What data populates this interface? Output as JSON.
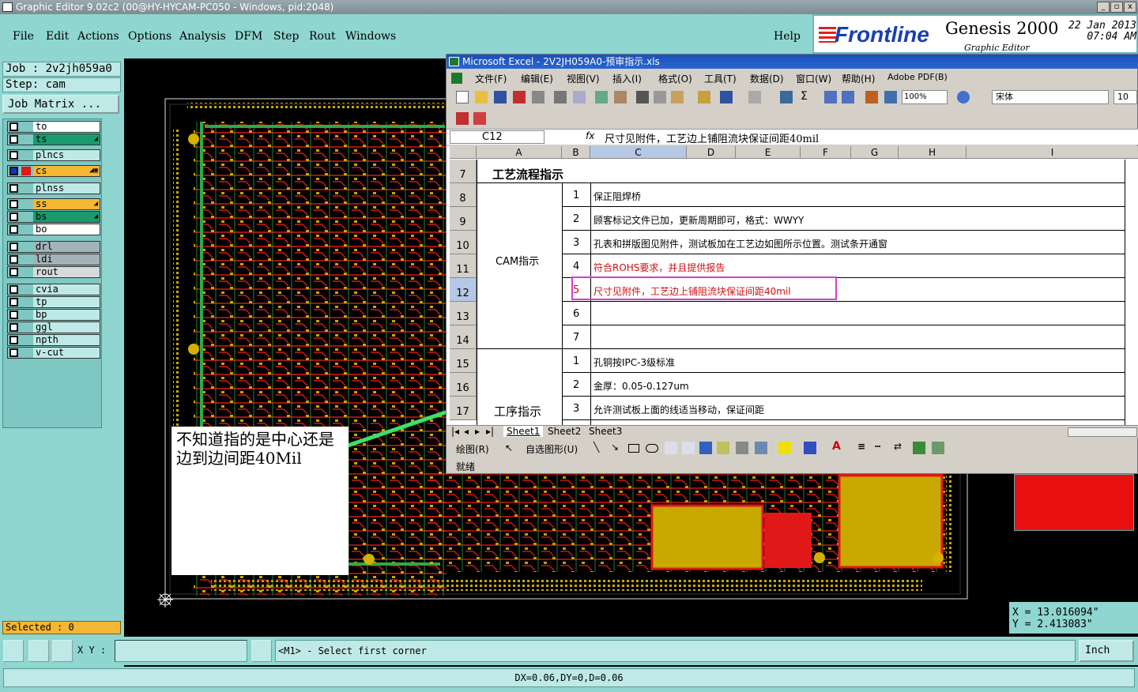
{
  "app": {
    "title": "Graphic Editor 9.02c2 (00@HY-HYCAM-PC050 - Windows, pid:2048)",
    "window_controls": [
      "_",
      "▫",
      "x"
    ]
  },
  "menu": [
    "File",
    "Edit",
    "Actions",
    "Options",
    "Analysis",
    "DFM",
    "Step",
    "Rout",
    "Windows"
  ],
  "help": "Help",
  "brand": {
    "logo": "Frontline",
    "product": "Genesis 2000",
    "subtitle": "Graphic Editor",
    "date": "22 Jan 2013",
    "time": "07:04 AM"
  },
  "job": {
    "job_line": "Job : 2v2jh059a0",
    "step_line": "Step: cam",
    "matrix_button": "Job Matrix ..."
  },
  "layers": [
    {
      "name": "to",
      "color": "#ffffff",
      "flag": ""
    },
    {
      "name": "ts",
      "color": "#1a9a6e",
      "flag": "◢"
    },
    {
      "name": "plncs",
      "color": "#bfe9e6",
      "flag": ""
    },
    {
      "name": "cs",
      "color": "#f5b733",
      "flag": "◢▣"
    },
    {
      "name": "plnss",
      "color": "#bfe9e6",
      "flag": ""
    },
    {
      "name": "ss",
      "color": "#f5b733",
      "flag": "◢"
    },
    {
      "name": "bs",
      "color": "#1a9a6e",
      "flag": "◢"
    },
    {
      "name": "bo",
      "color": "#ffffff",
      "flag": ""
    },
    {
      "name": "drl",
      "color": "#a4b3ba",
      "flag": ""
    },
    {
      "name": "ldi",
      "color": "#a4b3ba",
      "flag": ""
    },
    {
      "name": "rout",
      "color": "#d8dada",
      "flag": ""
    },
    {
      "name": "cvia",
      "color": "#bfe9e6",
      "flag": ""
    },
    {
      "name": "tp",
      "color": "#bfe9e6",
      "flag": ""
    },
    {
      "name": "bp",
      "color": "#bfe9e6",
      "flag": ""
    },
    {
      "name": "ggl",
      "color": "#bfe9e6",
      "flag": ""
    },
    {
      "name": "npth",
      "color": "#bfe9e6",
      "flag": ""
    },
    {
      "name": "v-cut",
      "color": "#bfe9e6",
      "flag": ""
    }
  ],
  "selected": "Selected : 0",
  "excel": {
    "title": "Microsoft Excel - 2V2JH059A0-预审指示.xls",
    "menu": [
      "文件(F)",
      "编辑(E)",
      "视图(V)",
      "插入(I)",
      "格式(O)",
      "工具(T)",
      "数据(D)",
      "窗口(W)",
      "帮助(H)",
      "Adobe PDF(B)"
    ],
    "zoom": "100%",
    "font": "宋体",
    "font_size": "10",
    "name_box": "C12",
    "fx": "fx",
    "formula": "尺寸见附件，工艺边上铺阻流块保证间距40mil",
    "columns": [
      "A",
      "B",
      "C",
      "D",
      "E",
      "F",
      "G",
      "H",
      "I"
    ],
    "rows": [
      {
        "num": "7",
        "a": "工艺流程指示",
        "b": "",
        "c": ""
      },
      {
        "num": "8",
        "a": "",
        "b": "1",
        "c": "保正阻焊桥"
      },
      {
        "num": "9",
        "a": "",
        "b": "2",
        "c": "顾客标记文件已加，更新周期即可，格式：WWYY"
      },
      {
        "num": "10",
        "a": "",
        "b": "3",
        "c": "孔表和拼版图见附件，测试板加在工艺边如图所示位置。测试条开通窗"
      },
      {
        "num": "11",
        "a": "CAM指示",
        "b": "4",
        "c": "符合ROHS要求，并且提供报告"
      },
      {
        "num": "12",
        "a": "",
        "b": "5",
        "c": "尺寸见附件，工艺边上铺阻流块保证间距40mil"
      },
      {
        "num": "13",
        "a": "",
        "b": "6",
        "c": ""
      },
      {
        "num": "14",
        "a": "",
        "b": "7",
        "c": ""
      },
      {
        "num": "15",
        "a": "",
        "b": "1",
        "c": "孔铜按IPC-3级标准"
      },
      {
        "num": "16",
        "a": "",
        "b": "2",
        "c": "金厚：0.05-0.127um"
      },
      {
        "num": "17",
        "a": "工序指示",
        "b": "3",
        "c": "允许测试板上面的线适当移动，保证间距"
      }
    ],
    "sheets": [
      "Sheet1",
      "Sheet2",
      "Sheet3"
    ],
    "draw_label": "绘图(R)",
    "autoshape_label": "自选图形(U)",
    "status": "就绪",
    "red_text_color": "#d01010"
  },
  "annotation": "不知道指的是中心还是边到边间距40Mil",
  "coords": {
    "x": "X = 13.016094\"",
    "y": "Y = 2.413083\""
  },
  "xy_label": "X Y :",
  "xy_value": "",
  "message": "<M1> - Select first corner",
  "unit": "Inch",
  "distance": "DX=0.06,DY=0,D=0.06"
}
